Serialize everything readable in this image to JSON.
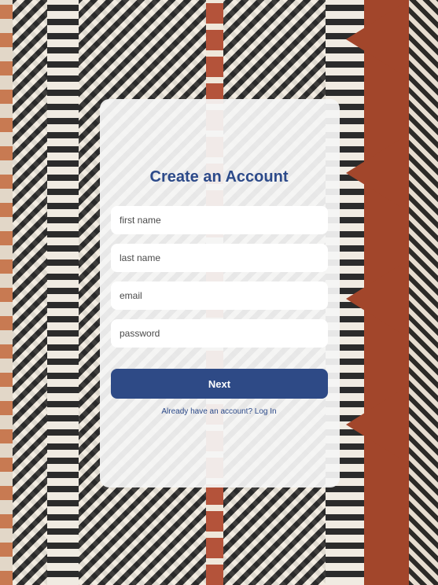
{
  "form": {
    "title": "Create an Account",
    "fields": [
      {
        "name": "first-name-input",
        "placeholder": "first name",
        "value": ""
      },
      {
        "name": "last-name-input",
        "placeholder": "last name",
        "value": ""
      },
      {
        "name": "email-input",
        "placeholder": "email",
        "value": ""
      },
      {
        "name": "password-input",
        "placeholder": "password",
        "value": ""
      }
    ],
    "next_label": "Next",
    "login_link": "Already have an account? Log In"
  },
  "colors": {
    "accent": "#2e4a86",
    "title": "#2c4a8a",
    "card_bg": "#f5f5f5"
  }
}
